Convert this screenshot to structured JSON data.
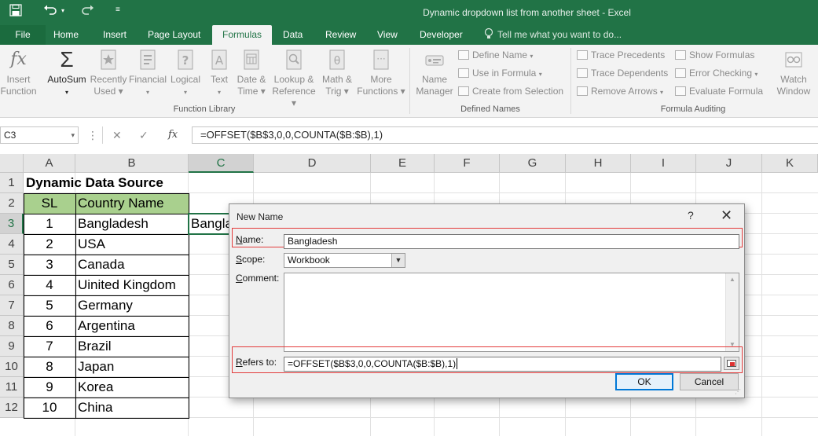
{
  "window": {
    "title": "Dynamic dropdown list from another sheet - Excel",
    "quick_access": [
      "save-icon",
      "undo-icon",
      "redo-icon",
      "customize-icon"
    ]
  },
  "tabs": [
    {
      "label": "File"
    },
    {
      "label": "Home"
    },
    {
      "label": "Insert"
    },
    {
      "label": "Page Layout"
    },
    {
      "label": "Formulas",
      "active": true
    },
    {
      "label": "Data"
    },
    {
      "label": "Review"
    },
    {
      "label": "View"
    },
    {
      "label": "Developer"
    }
  ],
  "tell_me": "Tell me what you want to do...",
  "ribbon": {
    "function_library": {
      "label": "Function Library",
      "insert_function": [
        "Insert",
        "Function"
      ],
      "autosum": "AutoSum",
      "recently_used": [
        "Recently",
        "Used"
      ],
      "financial": "Financial",
      "logical": "Logical",
      "text": "Text",
      "date_time": [
        "Date &",
        "Time"
      ],
      "lookup": [
        "Lookup &",
        "Reference"
      ],
      "math": [
        "Math &",
        "Trig"
      ],
      "more": [
        "More",
        "Functions"
      ]
    },
    "defined_names": {
      "label": "Defined Names",
      "name_manager": [
        "Name",
        "Manager"
      ],
      "define_name": "Define Name",
      "use_in_formula": "Use in Formula",
      "create_from_selection": "Create from Selection"
    },
    "formula_auditing": {
      "label": "Formula Auditing",
      "trace_precedents": "Trace Precedents",
      "trace_dependents": "Trace Dependents",
      "remove_arrows": "Remove Arrows",
      "show_formulas": "Show Formulas",
      "error_checking": "Error Checking",
      "evaluate_formula": "Evaluate Formula",
      "watch_window": [
        "Watch",
        "Window"
      ]
    }
  },
  "formula_bar": {
    "name_box": "C3",
    "cancel_icon": "✕",
    "enter_icon": "✓",
    "fx": "fx",
    "formula": "=OFFSET($B$3,0,0,COUNTA($B:$B),1)"
  },
  "grid": {
    "columns": [
      "A",
      "B",
      "C",
      "D",
      "E",
      "F",
      "G",
      "H",
      "I",
      "J",
      "K"
    ],
    "rows": [
      "1",
      "2",
      "3",
      "4",
      "5",
      "6",
      "7",
      "8",
      "9",
      "10",
      "11",
      "12"
    ],
    "title": "Dynamic Data Source",
    "header": {
      "sl": "SL",
      "country": "Country Name"
    },
    "data": [
      {
        "sl": "1",
        "country": "Bangladesh"
      },
      {
        "sl": "2",
        "country": "USA"
      },
      {
        "sl": "3",
        "country": "Canada"
      },
      {
        "sl": "4",
        "country": "Uinited Kingdom"
      },
      {
        "sl": "5",
        "country": "Germany"
      },
      {
        "sl": "6",
        "country": "Argentina"
      },
      {
        "sl": "7",
        "country": "Brazil"
      },
      {
        "sl": "8",
        "country": "Japan"
      },
      {
        "sl": "9",
        "country": "Korea"
      },
      {
        "sl": "10",
        "country": "China"
      }
    ],
    "c3_value": "Bangla",
    "colors": {
      "header_fill": "#a9d08e",
      "selection": "#217346"
    }
  },
  "dialog": {
    "title": "New Name",
    "help": "?",
    "close": "✕",
    "name_label": "Name:",
    "name_value": "Bangladesh",
    "scope_label": "Scope:",
    "scope_value": "Workbook",
    "comment_label": "Comment:",
    "refers_label": "Refers to:",
    "refers_value": "=OFFSET($B$3,0,0,COUNTA($B:$B),1)",
    "ok": "OK",
    "cancel": "Cancel",
    "highlight_color": "#e33b3b"
  }
}
